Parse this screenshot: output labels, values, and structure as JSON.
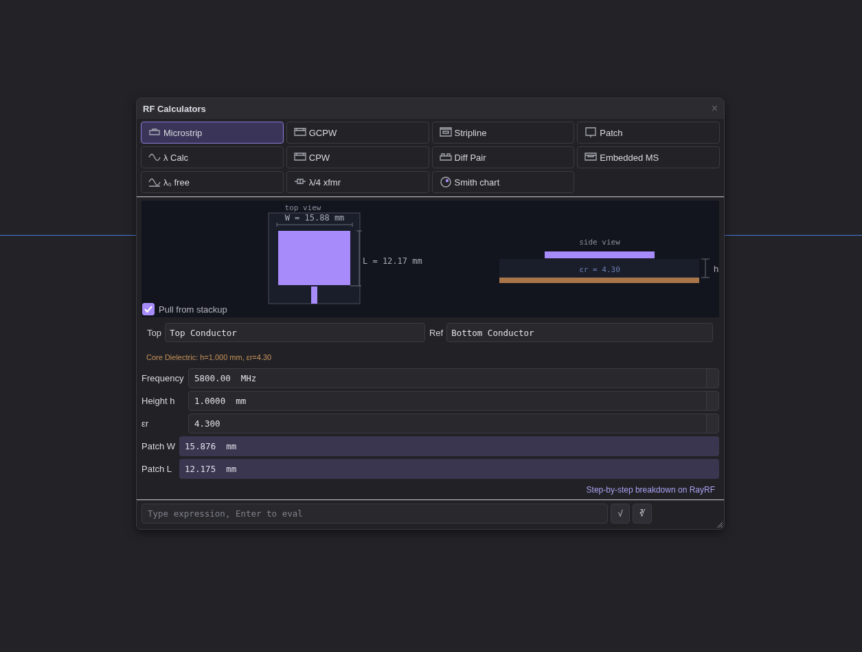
{
  "window": {
    "title": "RF Calculators",
    "close": "×"
  },
  "tools": [
    {
      "label": "Microstrip",
      "kind": "microstrip",
      "selected": true
    },
    {
      "label": "GCPW",
      "kind": "gcpw",
      "selected": false
    },
    {
      "label": "Stripline",
      "kind": "stripline",
      "selected": false
    },
    {
      "label": "Patch",
      "kind": "patch",
      "selected": false
    },
    {
      "label": "λ Calc",
      "kind": "wave",
      "selected": false
    },
    {
      "label": "CPW",
      "kind": "gcpw",
      "selected": false
    },
    {
      "label": "Diff Pair",
      "kind": "diffpair",
      "selected": false
    },
    {
      "label": "Embedded MS",
      "kind": "embedded",
      "selected": false
    },
    {
      "label": "λ₀ free",
      "kind": "wavefree",
      "selected": false
    },
    {
      "label": "λ/4 xfmr",
      "kind": "xfmr",
      "selected": false
    },
    {
      "label": "Smith chart",
      "kind": "smith",
      "selected": false
    }
  ],
  "diagram": {
    "top_view_title": "top view",
    "width_label": "W = 15.88 mm",
    "length_label": "L = 12.17 mm",
    "side_view_title": "side view",
    "er_label": "εr = 4.30",
    "h_label": "h"
  },
  "pull_from_stackup": {
    "label": "Pull from stackup",
    "checked": true
  },
  "layers": [
    {
      "label": "Top",
      "value": "Top Conductor"
    },
    {
      "label": "Ref",
      "value": "Bottom Conductor"
    }
  ],
  "stackup_note": "Core Dielectric: h=1.000 mm, εr=4.30",
  "params": [
    {
      "label": "Frequency",
      "value": "5800.00",
      "unit": "MHz",
      "kind": "input"
    },
    {
      "label": "Height h",
      "value": "1.0000",
      "unit": "mm",
      "kind": "input"
    },
    {
      "label": "εr",
      "value": "4.300",
      "kind": "input"
    },
    {
      "label": "Patch W",
      "value": "15.876",
      "unit": "mm",
      "kind": "output"
    },
    {
      "label": "Patch L",
      "value": "12.175",
      "unit": "mm",
      "kind": "output"
    }
  ],
  "link": "Step-by-step breakdown on RayRF",
  "expression": {
    "placeholder": "Type expression, Enter to eval",
    "buttons": [
      "√",
      "∛"
    ]
  }
}
